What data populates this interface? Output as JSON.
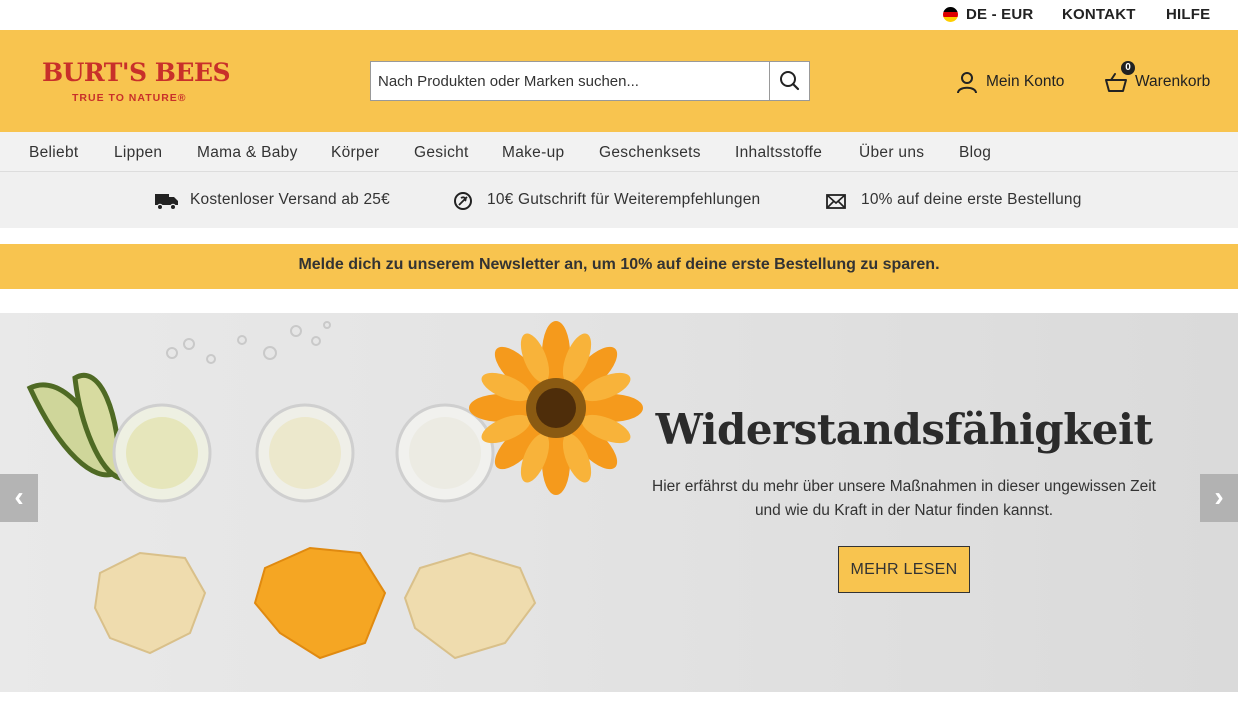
{
  "topbar": {
    "locale": "DE - EUR",
    "contact": "KONTAKT",
    "help": "HILFE"
  },
  "header": {
    "logo_brand": "BURT'S BEES",
    "logo_tagline": "TRUE TO NATURE®",
    "search_placeholder": "Nach Produkten oder Marken suchen...",
    "account_label": "Mein Konto",
    "cart_label": "Warenkorb",
    "cart_count": "0"
  },
  "nav": {
    "items": [
      "Beliebt",
      "Lippen",
      "Mama & Baby",
      "Körper",
      "Gesicht",
      "Make-up",
      "Geschenksets",
      "Inhaltsstoffe",
      "Über uns",
      "Blog"
    ]
  },
  "benefits": [
    {
      "icon": "truck-icon",
      "text": "Kostenloser Versand ab 25€"
    },
    {
      "icon": "coin-icon",
      "text": "10€ Gutschrift für Weiterempfehlungen"
    },
    {
      "icon": "envelope-icon",
      "text": "10% auf deine erste Bestellung"
    }
  ],
  "newsletter": {
    "text": "Melde dich zu unserem Newsletter an, um 10% auf deine erste Bestellung zu sparen."
  },
  "hero": {
    "title": "Widerstandsfähigkeit",
    "subtitle_line1": "Hier erfährst du mehr über unsere Maßnahmen in dieser ungewissen Zeit",
    "subtitle_line2": "und wie du Kraft in der Natur finden kannst.",
    "cta": "MEHR LESEN",
    "prev": "‹",
    "next": "›"
  },
  "colors": {
    "brand_yellow": "#f8c44f",
    "brand_red": "#c8302a",
    "nav_bg": "#f2f2f2"
  }
}
